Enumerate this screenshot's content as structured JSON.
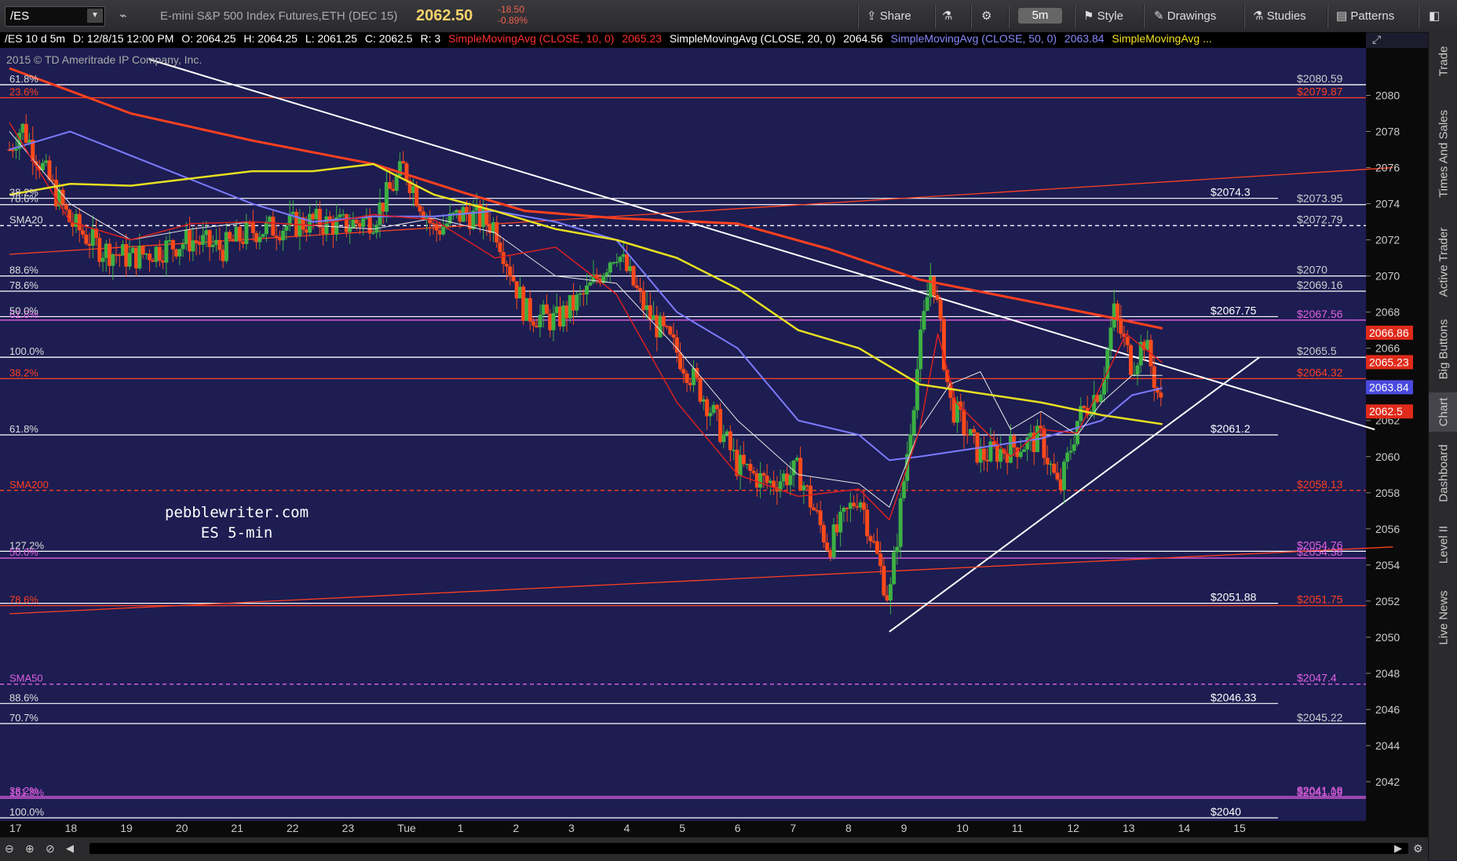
{
  "toolbar": {
    "symbol": "/ES",
    "description": "E-mini S&P 500 Index Futures,ETH (DEC 15)",
    "last": "2062.50",
    "change": "-18.50",
    "change_pct": "-0.89%",
    "share": "Share",
    "timeframe": "5m",
    "style": "Style",
    "drawings": "Drawings",
    "studies": "Studies",
    "patterns": "Patterns"
  },
  "infobar": {
    "header": "/ES 10 d 5m",
    "date": "D: 12/8/15 12:00 PM",
    "open": "O: 2064.25",
    "high": "H: 2064.25",
    "low": "L: 2061.25",
    "close": "C: 2062.5",
    "range": "R: 3",
    "sma10": "SimpleMovingAvg (CLOSE, 10, 0)",
    "sma10_val": "2065.23",
    "sma20": "SimpleMovingAvg (CLOSE, 20, 0)",
    "sma20_val": "2064.56",
    "sma50": "SimpleMovingAvg (CLOSE, 50, 0)",
    "sma50_val": "2063.84",
    "sma200": "SimpleMovingAvg ..."
  },
  "right_panel": [
    "Trade",
    "Times And Sales",
    "Active Trader",
    "Big Buttons",
    "Chart",
    "Dashboard",
    "Level II",
    "Live News"
  ],
  "active_panel": "Chart",
  "watermark": "2015 © TD Ameritrade IP Company, Inc.",
  "note": [
    "pebblewriter.com",
    "ES 5-min"
  ],
  "colors": {
    "bg": "#1d1d52",
    "candle_up": "#3cb043",
    "candle_down": "#ff4a1a",
    "sma10": "#d92020",
    "sma20": "#e8e8e8",
    "sma50": "#7b7bff",
    "sma200": "#ff4020",
    "yellow": "#e8e020",
    "fib_white": "#ffffff",
    "fib_red": "#ff4020",
    "fib_magenta": "#e060e0"
  },
  "chart_data": {
    "type": "candlestick",
    "ylim": [
      2040,
      2081.5
    ],
    "y_ticks": [
      "2080",
      "2078",
      "2076",
      "2074",
      "2072",
      "2070",
      "2068",
      "2066",
      "2064",
      "2062",
      "2060",
      "2058",
      "2056",
      "2054",
      "2052",
      "2050",
      "2048",
      "2046",
      "2044",
      "2042"
    ],
    "x_labels": [
      "17",
      "18",
      "19",
      "20",
      "21",
      "22",
      "23",
      "Tue",
      "1",
      "2",
      "3",
      "4",
      "5",
      "6",
      "7",
      "8",
      "9",
      "10",
      "11",
      "12",
      "13",
      "14",
      "15"
    ],
    "price_badges": [
      {
        "label": "2066.86",
        "value": 2066.86,
        "color": "#e02a1a"
      },
      {
        "label": "2065.23",
        "value": 2065.23,
        "color": "#e02a1a"
      },
      {
        "label": "2063.84",
        "value": 2063.84,
        "color": "#4a4adf"
      },
      {
        "label": "2062.5",
        "value": 2062.5,
        "color": "#e02a1a"
      }
    ],
    "levels": [
      {
        "value": 2080.59,
        "color": "#ffffff",
        "left": "61.8%",
        "right": "$2080.59",
        "rcolor": "#cccccc",
        "dash": false
      },
      {
        "value": 2079.87,
        "color": "#ff4020",
        "left": "23.6%",
        "right": "$2079.87",
        "rcolor": "#ff4020",
        "dash": false
      },
      {
        "value": 2073.95,
        "color": "#ffffff",
        "left": "78.6%",
        "right": "$2073.95",
        "rcolor": "#cccccc",
        "dash": false
      },
      {
        "value": 2072.79,
        "color": "#ffffff",
        "left": "SMA20",
        "right": "$2072.79",
        "rcolor": "#cccccc",
        "dash": true
      },
      {
        "value": 2070.0,
        "color": "#ffffff",
        "left": "88.6%",
        "right": "$2070",
        "rcolor": "#cccccc",
        "dash": false
      },
      {
        "value": 2069.16,
        "color": "#ffffff",
        "left": "78.6%",
        "right": "$2069.16",
        "rcolor": "#cccccc",
        "dash": false
      },
      {
        "value": 2067.56,
        "color": "#e060e0",
        "left": "61.8%",
        "right": "$2067.56",
        "rcolor": "#e060e0",
        "dash": false
      },
      {
        "value": 2065.5,
        "color": "#ffffff",
        "left": "100.0%",
        "right": "$2065.5",
        "rcolor": "#cccccc",
        "dash": false
      },
      {
        "value": 2064.32,
        "color": "#ff4020",
        "left": "38.2%",
        "right": "$2064.32",
        "rcolor": "#ff4020",
        "dash": false
      },
      {
        "value": 2058.13,
        "color": "#ff4020",
        "left": "SMA200",
        "right": "$2058.13",
        "rcolor": "#ff4020",
        "dash": true
      },
      {
        "value": 2054.76,
        "color": "#ffffff",
        "left": "127.2%",
        "right": "$2054.76",
        "rcolor": "#e060e0",
        "dash": false
      },
      {
        "value": 2054.38,
        "color": "#e060e0",
        "left": "50.0%",
        "right": "$2054.38",
        "rcolor": "#e060e0",
        "dash": false
      },
      {
        "value": 2051.75,
        "color": "#ff4020",
        "left": "78.6%",
        "right": "$2051.75",
        "rcolor": "#ff4020",
        "dash": false
      },
      {
        "value": 2047.4,
        "color": "#e060e0",
        "left": "SMA50",
        "right": "$2047.4",
        "rcolor": "#e060e0",
        "dash": true
      },
      {
        "value": 2045.22,
        "color": "#ffffff",
        "left": "70.7%",
        "right": "$2045.22",
        "rcolor": "#cccccc",
        "dash": false
      },
      {
        "value": 2041.18,
        "color": "#e060e0",
        "left": "38.2%",
        "right": "$2041.18",
        "rcolor": "#e060e0",
        "dash": false
      },
      {
        "value": 2041.09,
        "color": "#e060e0",
        "left": "161.8%",
        "right": "$2041.09",
        "rcolor": "#e060e0",
        "dash": false
      }
    ],
    "short_levels": [
      {
        "value": 2074.3,
        "label": "$2074.3"
      },
      {
        "value": 2067.75,
        "label": "$2067.75",
        "left": "50.0%"
      },
      {
        "value": 2061.2,
        "label": "$2061.2",
        "left": "61.8%"
      },
      {
        "value": 2051.88,
        "label": "$2051.88"
      },
      {
        "value": 2046.33,
        "label": "$2046.33",
        "left": "88.6%"
      },
      {
        "value": 2040.0,
        "label": "$2040",
        "left": "100.0%"
      }
    ],
    "extra_left_labels": [
      {
        "value": 2074.3,
        "label": "38.2%"
      }
    ],
    "trendlines": [
      {
        "color": "#ffffff",
        "p1": [
          2.3,
          2082.0
        ],
        "p2": [
          22.5,
          2061.5
        ]
      },
      {
        "color": "#ffffff",
        "p1": [
          14.5,
          2050.3
        ],
        "p2": [
          20.6,
          2065.5
        ]
      },
      {
        "color": "#ff4020",
        "p1": [
          0.0,
          2071.2
        ],
        "p2": [
          22.8,
          2076.0
        ]
      },
      {
        "color": "#ff4020",
        "p1": [
          0.0,
          2051.3
        ],
        "p2": [
          22.8,
          2055.0
        ]
      }
    ],
    "sma_paths": {
      "sma200": [
        [
          0,
          2081.5
        ],
        [
          2,
          2079
        ],
        [
          4,
          2077.5
        ],
        [
          6,
          2076.2
        ],
        [
          7.5,
          2074.6
        ],
        [
          8.5,
          2073.6
        ],
        [
          10,
          2073.2
        ],
        [
          12,
          2072.9
        ],
        [
          13.5,
          2071.5
        ],
        [
          15,
          2069.8
        ],
        [
          16.5,
          2068.8
        ],
        [
          18,
          2067.8
        ],
        [
          19,
          2067.1
        ]
      ],
      "sma50": [
        [
          0,
          2077
        ],
        [
          1,
          2078
        ],
        [
          2.5,
          2076
        ],
        [
          4,
          2074
        ],
        [
          5,
          2073
        ],
        [
          6,
          2073.3
        ],
        [
          7,
          2073.3
        ],
        [
          8,
          2073.6
        ],
        [
          9,
          2073
        ],
        [
          10,
          2072
        ],
        [
          11,
          2068
        ],
        [
          12,
          2066
        ],
        [
          13,
          2062
        ],
        [
          14,
          2061.2
        ],
        [
          14.5,
          2059.8
        ],
        [
          15,
          2060
        ],
        [
          16,
          2060.5
        ],
        [
          17,
          2061
        ],
        [
          18,
          2062
        ],
        [
          18.5,
          2063.4
        ],
        [
          19,
          2063.8
        ]
      ],
      "sma20": [
        [
          0,
          2078
        ],
        [
          1,
          2074
        ],
        [
          2,
          2072
        ],
        [
          3,
          2072.6
        ],
        [
          4,
          2073
        ],
        [
          5,
          2072.8
        ],
        [
          6,
          2072.6
        ],
        [
          7,
          2073.2
        ],
        [
          8,
          2072.4
        ],
        [
          9,
          2070
        ],
        [
          10,
          2069.6
        ],
        [
          11,
          2066
        ],
        [
          12,
          2062
        ],
        [
          13,
          2059
        ],
        [
          14,
          2058.5
        ],
        [
          14.5,
          2057.2
        ],
        [
          15,
          2061.5
        ],
        [
          15.5,
          2064
        ],
        [
          16,
          2064.7
        ],
        [
          16.5,
          2061.5
        ],
        [
          17,
          2062.5
        ],
        [
          17.6,
          2061.2
        ],
        [
          18,
          2063
        ],
        [
          18.5,
          2064.5
        ],
        [
          19,
          2064.5
        ]
      ],
      "sma10": [
        [
          0,
          2078.5
        ],
        [
          1,
          2073
        ],
        [
          2,
          2072
        ],
        [
          3,
          2072.9
        ],
        [
          4,
          2073
        ],
        [
          5,
          2072.8
        ],
        [
          6,
          2073.4
        ],
        [
          7,
          2073.1
        ],
        [
          8,
          2071
        ],
        [
          9,
          2071.6
        ],
        [
          10,
          2069
        ],
        [
          11,
          2063
        ],
        [
          12,
          2059
        ],
        [
          13,
          2057.8
        ],
        [
          14,
          2058.2
        ],
        [
          14.5,
          2056.5
        ],
        [
          15,
          2061.5
        ],
        [
          15.3,
          2066.8
        ],
        [
          15.6,
          2063
        ],
        [
          16.5,
          2060
        ],
        [
          17,
          2061.5
        ],
        [
          17.6,
          2061.3
        ],
        [
          18,
          2064
        ],
        [
          18.4,
          2066.8
        ],
        [
          19,
          2065.2
        ]
      ],
      "yellow": [
        [
          0,
          2074.5
        ],
        [
          1,
          2075.1
        ],
        [
          2,
          2075
        ],
        [
          3,
          2075.4
        ],
        [
          4,
          2075.8
        ],
        [
          5,
          2075.8
        ],
        [
          6,
          2076.2
        ],
        [
          7,
          2074.5
        ],
        [
          8,
          2073.6
        ],
        [
          9,
          2072.6
        ],
        [
          10,
          2072
        ],
        [
          11,
          2071
        ],
        [
          12,
          2069.3
        ],
        [
          13,
          2067
        ],
        [
          14,
          2066
        ],
        [
          15,
          2064
        ],
        [
          16,
          2063.5
        ],
        [
          17,
          2063
        ],
        [
          18,
          2062.3
        ],
        [
          19,
          2061.8
        ]
      ]
    },
    "candles_seed": 7,
    "candle_path": [
      [
        0,
        2077
      ],
      [
        0.2,
        2078.3
      ],
      [
        1,
        2073
      ],
      [
        1.5,
        2071.5
      ],
      [
        2,
        2071
      ],
      [
        3,
        2072
      ],
      [
        3.5,
        2071.5
      ],
      [
        4,
        2072.5
      ],
      [
        5,
        2073
      ],
      [
        5.5,
        2072.8
      ],
      [
        6,
        2073.2
      ],
      [
        6.5,
        2076
      ],
      [
        7,
        2072.5
      ],
      [
        7.5,
        2073.5
      ],
      [
        8,
        2072.8
      ],
      [
        8.5,
        2068
      ],
      [
        9,
        2067.5
      ],
      [
        9.5,
        2069
      ],
      [
        10,
        2071.5
      ],
      [
        10.5,
        2068
      ],
      [
        11,
        2065.8
      ],
      [
        11.5,
        2063
      ],
      [
        12,
        2059.5
      ],
      [
        12.5,
        2058.5
      ],
      [
        13,
        2059.2
      ],
      [
        13.5,
        2055
      ],
      [
        14,
        2058
      ],
      [
        14.5,
        2052
      ],
      [
        15,
        2066
      ],
      [
        15.2,
        2070.5
      ],
      [
        15.5,
        2063
      ],
      [
        16,
        2060
      ],
      [
        16.5,
        2060.5
      ],
      [
        17,
        2061
      ],
      [
        17.3,
        2058
      ],
      [
        17.6,
        2062
      ],
      [
        18,
        2064
      ],
      [
        18.2,
        2068
      ],
      [
        18.5,
        2065
      ],
      [
        18.7,
        2066.5
      ],
      [
        19,
        2062.5
      ]
    ]
  }
}
